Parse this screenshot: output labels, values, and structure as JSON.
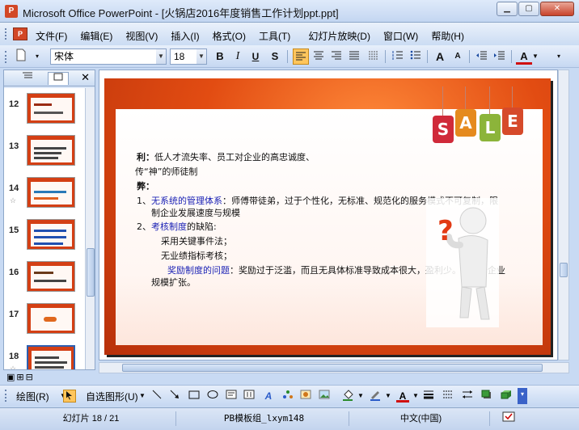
{
  "window": {
    "app_icon_text": "P",
    "title": "Microsoft Office PowerPoint - [火锅店2016年度销售工作计划ppt.ppt]",
    "minimize_glyph": "▁",
    "maximize_glyph": "▢",
    "close_glyph": "✕"
  },
  "menu": {
    "doc_icon_text": "P",
    "items": [
      {
        "label": "文件(F)"
      },
      {
        "label": "编辑(E)"
      },
      {
        "label": "视图(V)"
      },
      {
        "label": "插入(I)"
      },
      {
        "label": "格式(O)"
      },
      {
        "label": "工具(T)"
      },
      {
        "label": "幻灯片放映(D)"
      },
      {
        "label": "窗口(W)"
      },
      {
        "label": "帮助(H)"
      }
    ]
  },
  "toolbar": {
    "font_name": "宋体",
    "font_size": "18",
    "bold": "B",
    "italic": "I",
    "underline": "U",
    "shadow": "S",
    "grow_font": "A",
    "shrink_font": "A",
    "font_color": "A"
  },
  "slide_panel": {
    "close_glyph": "✕",
    "thumbnails": [
      {
        "number": "12"
      },
      {
        "number": "13"
      },
      {
        "number": "14",
        "star": "☆"
      },
      {
        "number": "15"
      },
      {
        "number": "16"
      },
      {
        "number": "17"
      },
      {
        "number": "18",
        "star": "☆"
      }
    ]
  },
  "slide": {
    "tags": [
      "S",
      "A",
      "L",
      "E"
    ],
    "tag_colors": [
      "#d02a3a",
      "#e58a1e",
      "#8cb43a",
      "#d64a2a"
    ],
    "lines": {
      "l1_bold": "利：",
      "l1_rest": "低人才流失率、员工对企业的高忠诚度、",
      "l2": "传“神”的师徒制",
      "l3_bold": "弊：",
      "l4_num": "1、",
      "l4_blue": "无系统的管理体系",
      "l4_rest": "：师傅带徒弟，过于个性化，无标准、规范化的服务模式不可复制，限",
      "l5": "制企业发展速度与规模",
      "l6_num": "2、",
      "l6_blue": "考核制度",
      "l6_rest": "的缺陷:",
      "l7": "采用关键事件法；",
      "l8": "无业绩指标考核；",
      "l9_blue": "奖励制度的问题",
      "l9_rest": "：奖励过于泛滥，而且无具体标准导致成本很大，盈利少。不利于企业",
      "l10": "规模扩张。"
    }
  },
  "drawbar": {
    "draw_label": "绘图(R)",
    "autoshapes_label": "自选图形(U)"
  },
  "status": {
    "slide_pos": "幻灯片 18 / 21",
    "template": "PB模板组_lxym148",
    "language": "中文(中国)"
  }
}
